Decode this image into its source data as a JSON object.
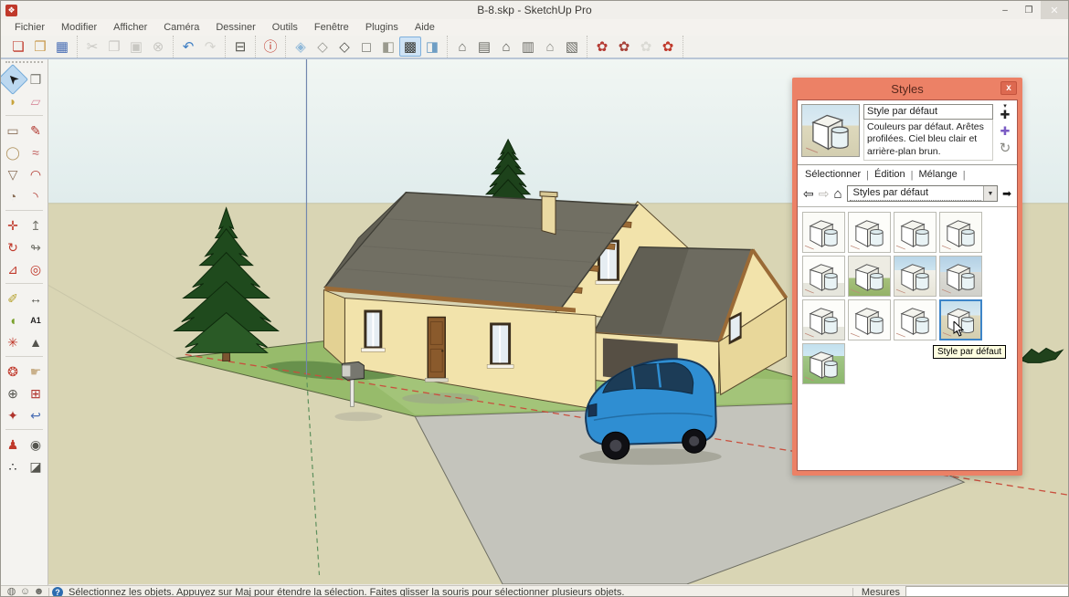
{
  "window": {
    "title": "B-8.skp - SketchUp Pro",
    "logo_glyph": "❖",
    "minimize_glyph": "–",
    "restore_glyph": "❐",
    "close_glyph": "✕"
  },
  "menu_bar": {
    "items": [
      "Fichier",
      "Modifier",
      "Afficher",
      "Caméra",
      "Dessiner",
      "Outils",
      "Fenêtre",
      "Plugins",
      "Aide"
    ]
  },
  "toolbar": {
    "groups": [
      {
        "name": "file",
        "icons": [
          {
            "name": "new-file-button",
            "glyph": "❏",
            "color": "#c0392b"
          },
          {
            "name": "open-file-button",
            "glyph": "❒",
            "color": "#c99a4e"
          },
          {
            "name": "save-button",
            "glyph": "▦",
            "color": "#4a6fb5"
          }
        ]
      },
      {
        "name": "edit",
        "icons": [
          {
            "name": "cut-button",
            "glyph": "✂",
            "color": "#8a8a84",
            "disabled": true
          },
          {
            "name": "copy-button",
            "glyph": "❐",
            "color": "#8a8a84",
            "disabled": true
          },
          {
            "name": "paste-button",
            "glyph": "▣",
            "color": "#8a8a84",
            "disabled": true
          },
          {
            "name": "erase-button",
            "glyph": "⊗",
            "color": "#8a8a84",
            "disabled": true
          }
        ]
      },
      {
        "name": "undo-redo",
        "icons": [
          {
            "name": "undo-button",
            "glyph": "↶",
            "color": "#3f7fc4"
          },
          {
            "name": "redo-button",
            "glyph": "↷",
            "color": "#a9a9a2",
            "disabled": true
          }
        ]
      },
      {
        "name": "print",
        "icons": [
          {
            "name": "print-button",
            "glyph": "⊟",
            "color": "#55554f"
          }
        ]
      },
      {
        "name": "model-info",
        "icons": [
          {
            "name": "model-info-button",
            "glyph": "ⓘ",
            "color": "#c0392b"
          }
        ]
      },
      {
        "name": "face-style",
        "icons": [
          {
            "name": "xray-style-button",
            "glyph": "◈",
            "color": "#8fb8d8"
          },
          {
            "name": "back-edges-style-button",
            "glyph": "◇",
            "color": "#9a9a94"
          },
          {
            "name": "wireframe-style-button",
            "glyph": "◇",
            "color": "#55554f"
          },
          {
            "name": "hidden-line-style-button",
            "glyph": "◻",
            "color": "#8a8a84"
          },
          {
            "name": "shaded-style-button",
            "glyph": "◧",
            "color": "#9a9a8e"
          },
          {
            "name": "shaded-textures-style-button",
            "glyph": "▩",
            "color": "#3a3a35",
            "selected": true
          },
          {
            "name": "monochrome-style-button",
            "glyph": "◨",
            "color": "#6f9ec4"
          }
        ]
      },
      {
        "name": "views",
        "icons": [
          {
            "name": "iso-view-button",
            "glyph": "⌂",
            "color": "#6a6a64"
          },
          {
            "name": "top-view-button",
            "glyph": "▤",
            "color": "#6a6a64"
          },
          {
            "name": "front-view-button",
            "glyph": "⌂",
            "color": "#55554f"
          },
          {
            "name": "right-view-button",
            "glyph": "▥",
            "color": "#6a6a64"
          },
          {
            "name": "back-view-button",
            "glyph": "⌂",
            "color": "#8a8a84"
          },
          {
            "name": "left-view-button",
            "glyph": "▧",
            "color": "#6a6a64"
          }
        ]
      },
      {
        "name": "dynamic-components",
        "icons": [
          {
            "name": "interact-component-button",
            "glyph": "✿",
            "color": "#b53b33"
          },
          {
            "name": "component-options-button",
            "glyph": "✿",
            "color": "#a8433a"
          },
          {
            "name": "component-attributes-button",
            "glyph": "✿",
            "color": "#b8b8b0",
            "disabled": true
          },
          {
            "name": "component-exchange-button",
            "glyph": "✿",
            "color": "#c0392b"
          }
        ]
      }
    ]
  },
  "left_toolbar": {
    "items": [
      {
        "name": "select-tool",
        "glyph": "➤",
        "color": "#1a1a1a",
        "selected": true,
        "cls": "sel-arrow"
      },
      {
        "name": "make-component-tool",
        "glyph": "❒",
        "color": "#77776f"
      },
      {
        "name": "paint-bucket-tool",
        "glyph": "◗",
        "color": "#c8a43c"
      },
      {
        "name": "eraser-tool",
        "glyph": "▱",
        "color": "#d88c9c"
      },
      {
        "sep": true
      },
      {
        "name": "rectangle-tool",
        "glyph": "▭",
        "color": "#8a6f58"
      },
      {
        "name": "line-tool",
        "glyph": "✎",
        "color": "#b0342c"
      },
      {
        "name": "circle-tool",
        "glyph": "◯",
        "color": "#b59a6a"
      },
      {
        "name": "freehand-tool",
        "glyph": "≈",
        "color": "#c05a5a"
      },
      {
        "name": "polygon-tool",
        "glyph": "▽",
        "color": "#8a6f58"
      },
      {
        "name": "arc-tool",
        "glyph": "◠",
        "color": "#b0342c"
      },
      {
        "name": "pie-tool",
        "glyph": "◔",
        "color": "#8a6f58"
      },
      {
        "name": "two-point-arc-tool",
        "glyph": "◝",
        "color": "#b0342c"
      },
      {
        "sep": true
      },
      {
        "name": "move-tool",
        "glyph": "✛",
        "color": "#c0392b"
      },
      {
        "name": "push-pull-tool",
        "glyph": "↥",
        "color": "#77776f"
      },
      {
        "name": "rotate-tool",
        "glyph": "↻",
        "color": "#c0392b"
      },
      {
        "name": "follow-me-tool",
        "glyph": "↬",
        "color": "#77776f"
      },
      {
        "name": "scale-tool",
        "glyph": "⊿",
        "color": "#c0392b"
      },
      {
        "name": "offset-tool",
        "glyph": "◎",
        "color": "#c0392b"
      },
      {
        "sep": true
      },
      {
        "name": "tape-measure-tool",
        "glyph": "✐",
        "color": "#b5a12c"
      },
      {
        "name": "dimension-tool",
        "glyph": "↔",
        "color": "#55554f"
      },
      {
        "name": "protractor-tool",
        "glyph": "◖",
        "color": "#7aa12c"
      },
      {
        "name": "text-tool",
        "glyph": "A1",
        "color": "#222222",
        "cls": "txt"
      },
      {
        "name": "axes-tool",
        "glyph": "✳",
        "color": "#c0392b"
      },
      {
        "name": "three-d-text-tool",
        "glyph": "▲",
        "color": "#55554f"
      },
      {
        "sep": true
      },
      {
        "name": "orbit-tool",
        "glyph": "❂",
        "color": "#c0392b"
      },
      {
        "name": "pan-tool",
        "glyph": "☛",
        "color": "#c9b08a"
      },
      {
        "name": "zoom-tool",
        "glyph": "⊕",
        "color": "#55554f"
      },
      {
        "name": "zoom-window-tool",
        "glyph": "⊞",
        "color": "#b0342c"
      },
      {
        "name": "zoom-extents-tool",
        "glyph": "✦",
        "color": "#b0342c"
      },
      {
        "name": "previous-view-tool",
        "glyph": "↩",
        "color": "#4a6fb5"
      },
      {
        "sep": true
      },
      {
        "name": "position-camera-tool",
        "glyph": "♟",
        "color": "#c0392b"
      },
      {
        "name": "look-around-tool",
        "glyph": "◉",
        "color": "#55554f"
      },
      {
        "name": "walk-tool",
        "glyph": "∴",
        "color": "#222222"
      },
      {
        "name": "section-plane-tool",
        "glyph": "◪",
        "color": "#55554f"
      }
    ]
  },
  "viewport": {
    "colors": {
      "sky": "#eaf2f0",
      "ground": "#d9d5b4",
      "grass": "#97bb6b",
      "road": "#c4c4bc",
      "roof": "#716f63",
      "wall": "#f2e3ab",
      "trim": "#9a6a36",
      "car": "#2f8ed2",
      "axis_red": "#c94f3d",
      "axis_green": "#5d8f5d",
      "axis_blue": "#7287ae"
    }
  },
  "styles_panel": {
    "title": "Styles",
    "close_glyph": "x",
    "style_name": "Style par défaut",
    "style_description": "Couleurs par défaut. Arêtes profilées. Ciel bleu clair et arrière-plan brun.",
    "side_create_arrow": "▾",
    "side_create_glyph": "✚",
    "side_update_glyph": "✚",
    "side_refresh_glyph": "↻",
    "tabs": [
      {
        "label": "Sélectionner",
        "active": true
      },
      {
        "label": "Édition",
        "active": false
      },
      {
        "label": "Mélange",
        "active": false
      }
    ],
    "nav": {
      "back_glyph": "⇦",
      "forward_glyph": "⇨",
      "home_glyph": "⌂",
      "dropdown_value": "Styles par défaut",
      "dropdown_arrow": "▼",
      "detail_glyph": "➡"
    },
    "thumbnails": [
      {
        "variant": "sketch"
      },
      {
        "variant": "white"
      },
      {
        "variant": "white"
      },
      {
        "variant": "sketch"
      },
      {
        "variant": "shadow"
      },
      {
        "variant": "green-ground"
      },
      {
        "variant": "sky"
      },
      {
        "variant": "sky-gray"
      },
      {
        "variant": "shadow"
      },
      {
        "variant": "white"
      },
      {
        "variant": "white"
      },
      {
        "variant": "sky-tan",
        "selected": true
      },
      {
        "variant": "green-sky"
      }
    ],
    "tooltip": "Style par défaut"
  },
  "status_bar": {
    "icons": [
      {
        "name": "geolocation-icon",
        "glyph": "◍"
      },
      {
        "name": "credits-icon",
        "glyph": "☺"
      },
      {
        "name": "sign-in-icon",
        "glyph": "☻"
      }
    ],
    "help_glyph": "?",
    "message": "Sélectionnez les objets. Appuyez sur Maj pour étendre la sélection. Faites glisser la souris pour sélectionner plusieurs objets.",
    "measurements_label": "Mesures",
    "measurements_value": ""
  }
}
